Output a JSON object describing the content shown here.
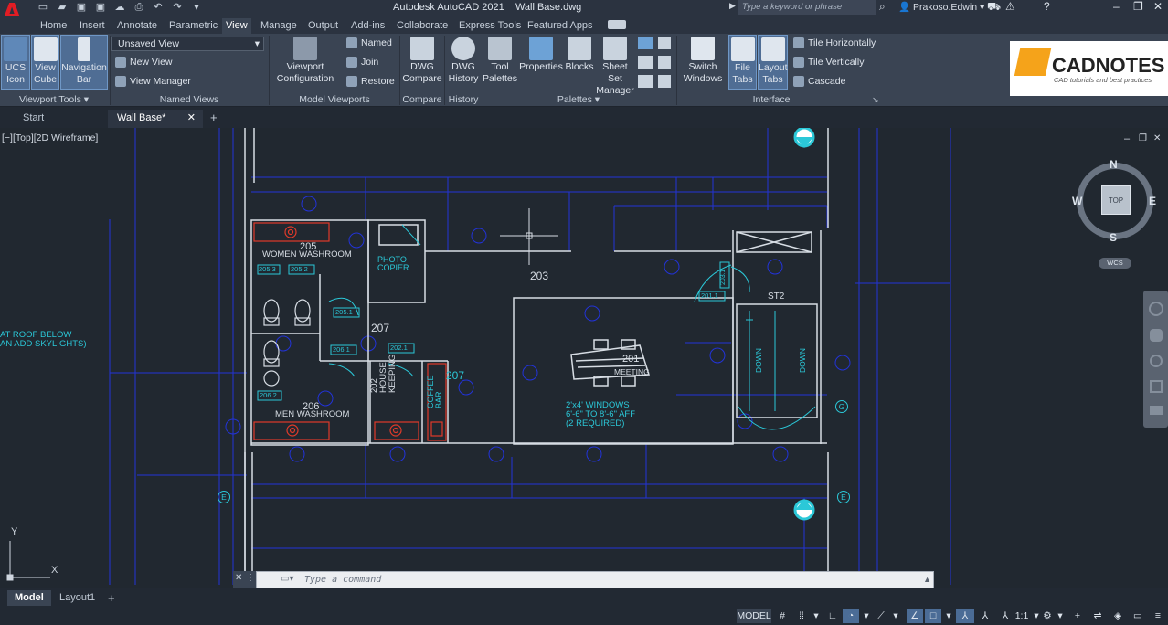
{
  "title": {
    "app": "Autodesk AutoCAD 2021",
    "file": "Wall Base.dwg"
  },
  "search": {
    "placeholder": "Type a keyword or phrase"
  },
  "user": {
    "name": "Prakoso.Edwin"
  },
  "ribbon_tabs": [
    "Home",
    "Insert",
    "Annotate",
    "Parametric",
    "View",
    "Manage",
    "Output",
    "Add-ins",
    "Collaborate",
    "Express Tools",
    "Featured Apps"
  ],
  "active_tab": "View",
  "ribbon": {
    "viewport_tools": {
      "label": "Viewport Tools",
      "ucs_icon": [
        "UCS",
        "Icon"
      ],
      "view_cube": [
        "View",
        "Cube"
      ],
      "navigation_bar": [
        "Navigation",
        "Bar"
      ]
    },
    "named_views": {
      "label": "Named Views",
      "dropdown": "Unsaved View",
      "new_view": "New View",
      "view_manager": "View Manager"
    },
    "model_viewports": {
      "label": "Model Viewports",
      "viewport_config": [
        "Viewport",
        "Configuration"
      ],
      "named": "Named",
      "join": "Join",
      "restore": "Restore"
    },
    "compare": {
      "label": "Compare",
      "dwg_compare": [
        "DWG",
        "Compare"
      ]
    },
    "history": {
      "label": "History",
      "dwg_history": [
        "DWG",
        "History"
      ]
    },
    "palettes": {
      "label": "Palettes",
      "tool_palettes": [
        "Tool",
        "Palettes"
      ],
      "properties": "Properties",
      "blocks": "Blocks",
      "sheet_set": [
        "Sheet Set",
        "Manager"
      ]
    },
    "interface": {
      "label": "Interface",
      "switch_windows": [
        "Switch",
        "Windows"
      ],
      "file_tabs": [
        "File",
        "Tabs"
      ],
      "layout_tabs": [
        "Layout",
        "Tabs"
      ],
      "tile_h": "Tile Horizontally",
      "tile_v": "Tile Vertically",
      "cascade": "Cascade"
    }
  },
  "logo": {
    "brand": "CADNOTES",
    "tagline": "CAD tutorials and best practices"
  },
  "doc_tabs": {
    "start": "Start",
    "active": "Wall Base*"
  },
  "viewport": {
    "label": "[−][Top][2D Wireframe]"
  },
  "viewcube": {
    "n": "N",
    "s": "S",
    "e": "E",
    "w": "W",
    "face": "TOP",
    "wcs": "WCS"
  },
  "drawing": {
    "rooms": {
      "r205": "205",
      "women_washroom": "WOMEN  WASHROOM",
      "r206": "206",
      "men_washroom": "MEN  WASHROOM",
      "r207": "207",
      "r207b": "207",
      "r203": "203",
      "photo": "PHOTO",
      "copier": "COPIER",
      "r202": "202",
      "house": "HOUSE",
      "keeping": "KEEPING",
      "coffee": "COFFEE",
      "bar": "BAR",
      "r201": "201",
      "meeting": "MEETING",
      "st2": "ST2",
      "down": "DOWN",
      "windows_1": "2'x4'  WINDOWS",
      "windows_2": "6'-6\"  TO  8'-6\"  AFF",
      "windows_3": "(2  REQUIRED)",
      "roof_1": "AT  ROOF  BELOW",
      "roof_2": "AN  ADD  SKYLIGHTS)"
    },
    "tags": [
      "205.1",
      "205.2",
      "205.3",
      "206.1",
      "206.2",
      "202.1",
      "201.1",
      "203.1"
    ],
    "grid": {
      "e": "E",
      "g": "G"
    }
  },
  "command": {
    "placeholder": "Type a command"
  },
  "layout_tabs": [
    "Model",
    "Layout1"
  ],
  "status": {
    "model": "MODEL",
    "scale": "1:1"
  },
  "colors": {
    "accent": "#4b6c96",
    "drawing_blue": "#2b3de6",
    "drawing_cyan": "#2bc8d8",
    "drawing_red": "#e03a2a"
  }
}
